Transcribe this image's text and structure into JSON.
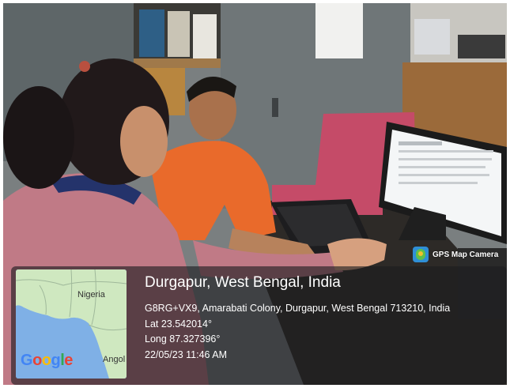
{
  "photo": {
    "description_icon": "photo-scene"
  },
  "badge": {
    "label": "GPS Map Camera",
    "icon": "gps-map-camera-icon"
  },
  "map": {
    "label_nigeria": "Nigeria",
    "label_angola": "Angol",
    "logo_text": "Google",
    "colors": {
      "water": "#7fb0e6",
      "land": "#cfe8c0"
    }
  },
  "location": {
    "title": "Durgapur, West Bengal, India",
    "address": "G8RG+VX9, Amarabati Colony, Durgapur, West Bengal 713210, India",
    "lat": "Lat 23.542014°",
    "long": "Long 87.327396°",
    "datetime": "22/05/23 11:46 AM"
  }
}
